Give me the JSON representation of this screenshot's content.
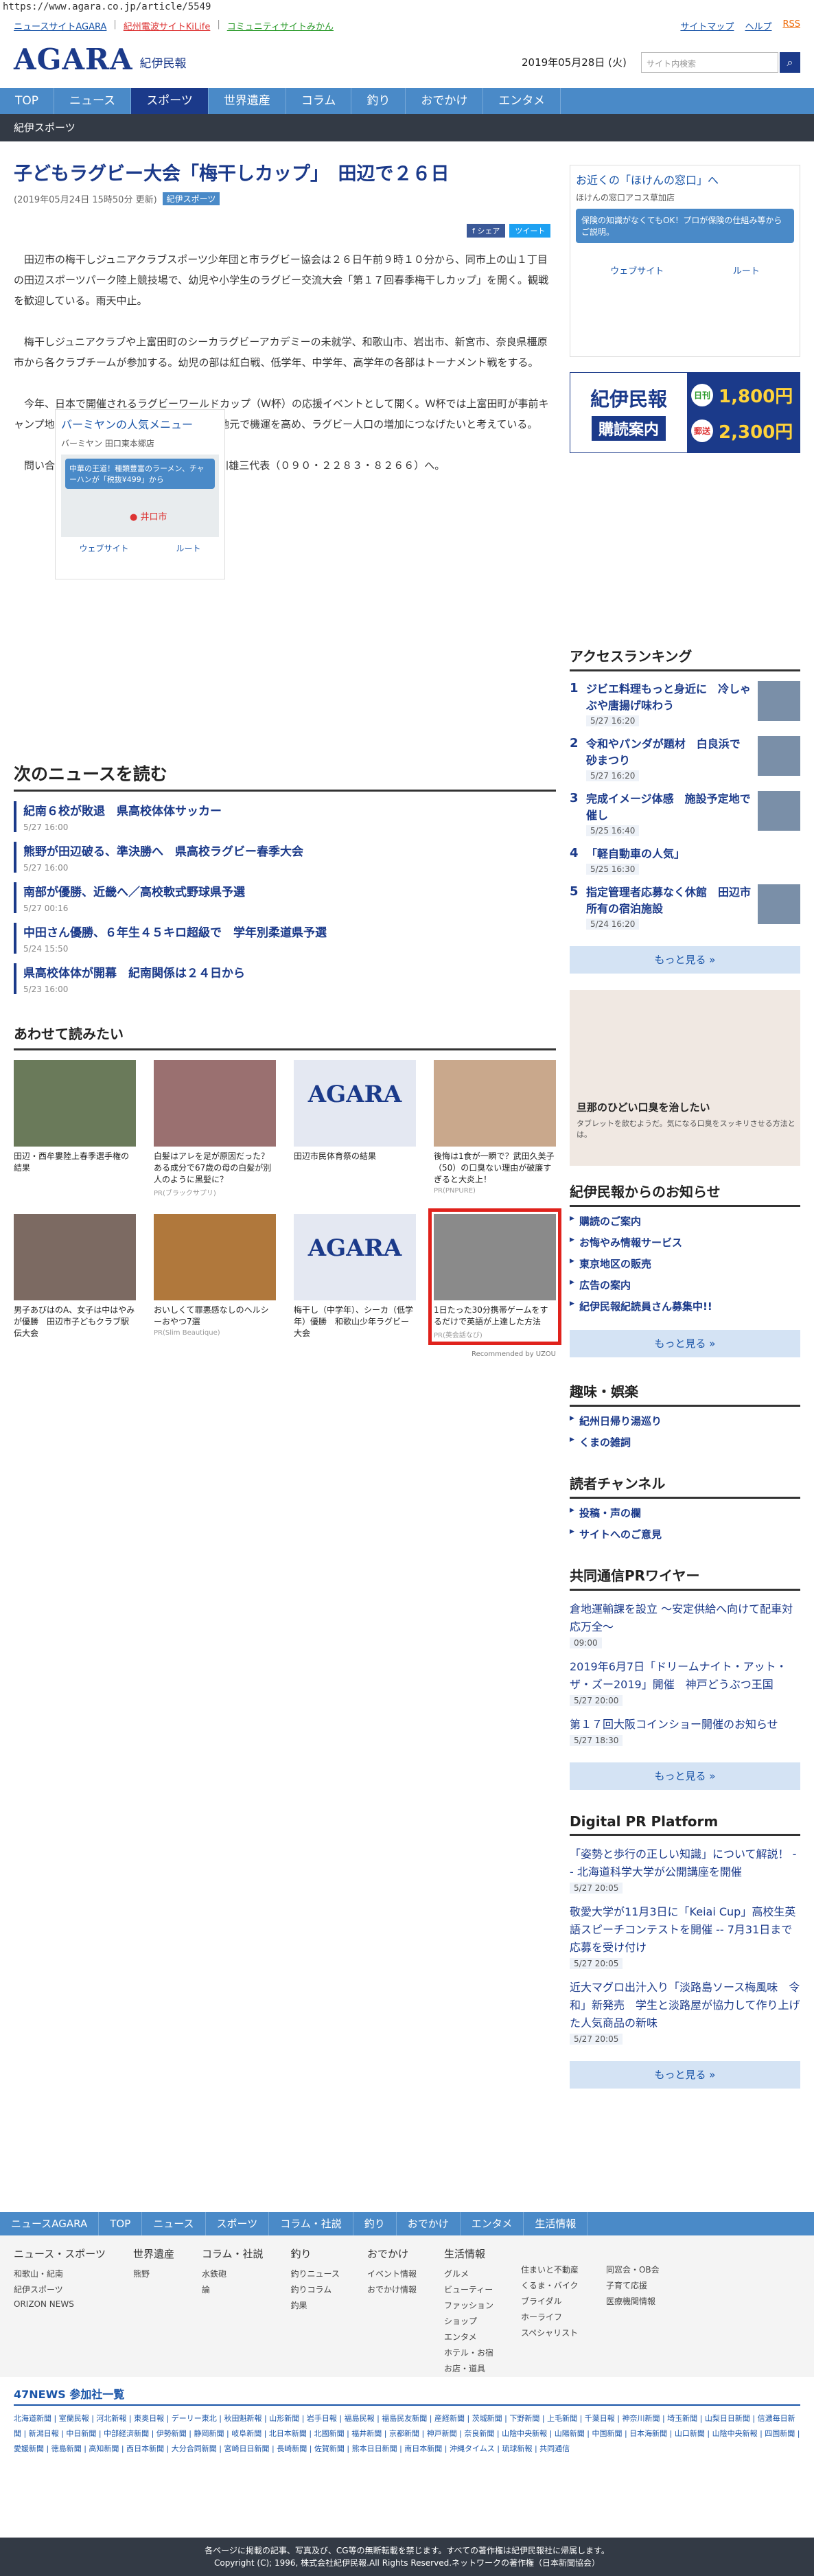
{
  "url": "https://www.agara.co.jp/article/5549",
  "toplinks": [
    "ニュースサイトAGARA",
    "紀州電波サイトKiLife",
    "コミュニティサイトみかん"
  ],
  "toprlinks": [
    "サイトマップ",
    "ヘルプ",
    "RSS"
  ],
  "logo": {
    "big": "AGARA",
    "small": "紀伊民報"
  },
  "date": "2019年05月28日 (火)",
  "search": {
    "placeholder": "サイト内検索"
  },
  "nav": [
    "TOP",
    "ニュース",
    "スポーツ",
    "世界遺産",
    "コラム",
    "釣り",
    "おでかけ",
    "エンタメ"
  ],
  "subnav": "紀伊スポーツ",
  "article": {
    "title": "子どもラグビー大会「梅干しカップ」　田辺で２６日",
    "meta": "(2019年05月24日 15時50分 更新)",
    "tag": "紀伊スポーツ",
    "share": [
      "f シェア",
      "ツイート"
    ],
    "paras": [
      "田辺市の梅干しジュニアクラブスポーツ少年団と市ラグビー協会は２６日午前９時１０分から、同市上の山１丁目の田辺スポーツパーク陸上競技場で、幼児や小学生のラグビー交流大会「第１７回春季梅干しカップ」を開く。観戦を歓迎している。雨天中止。",
      "梅干しジュニアクラブや上富田町のシーカラグビーアカデミーの未就学、和歌山市、岩出市、新宮市、奈良県橿原市から各クラブチームが参加する。幼児の部は紅白戦、低学年、中学年、高学年の各部はトーナメント戦をする。",
      "今年、日本で開催されるラグビーワールドカップ（Ｗ杯）の応援イベントとして開く。Ｗ杯では上富田町が事前キャンプ地の一つに選ばれている。主催者側は地元で機運を高め、ラグビー人口の増加につなげたいと考えている。",
      "問い合わせは、梅干しジュニアクラブの小川雄三代表（０９０・２２８３・８２６６）へ。"
    ]
  },
  "ad1": {
    "title": "バーミヤンの人気メニュー",
    "sub": "バーミヤン 田口東本郷店",
    "bubble": "中華の王道！種類豊富のラーメン、チャーハンが「税抜¥499」から",
    "pin": "井口市",
    "links": [
      "ウェブサイト",
      "ルート"
    ]
  },
  "next": {
    "heading": "次のニュースを読む",
    "items": [
      {
        "title": "紀南６校が敗退　県高校体体サッカー",
        "time": "5/27 16:00"
      },
      {
        "title": "熊野が田辺破る、準決勝へ　県高校ラグビー春季大会",
        "time": "5/27 16:00"
      },
      {
        "title": "南部が優勝、近畿へ／高校軟式野球県予選",
        "time": "5/27 00:16"
      },
      {
        "title": "中田さん優勝、６年生４５キロ超級で　学年別柔道県予選",
        "time": "5/24 15:50"
      },
      {
        "title": "県高校体体が開幕　紀南関係は２４日から",
        "time": "5/23 16:00"
      }
    ]
  },
  "related": {
    "heading": "あわせて読みたい",
    "cards": [
      {
        "cap": "田辺・西牟婁陸上春季選手権の結果",
        "pr": ""
      },
      {
        "cap": "白髪はアレを足が原因だった？ある成分で67歳の母の白髪が別人のように黒髪に？",
        "pr": "PR(ブラックサプリ)"
      },
      {
        "cap": "田辺市民体育祭の結果",
        "pr": ""
      },
      {
        "cap": "後悔は1食が一瞬で？武田久美子（50）の口臭ない理由が破廉すぎると大炎上！",
        "pr": "PR(PNPURE)"
      },
      {
        "cap": "男子あびはのA、女子は中はやみが優勝　田辺市子どもクラブ駅伝大会",
        "pr": ""
      },
      {
        "cap": "おいしくて罪悪感なしのヘルシーおやつ7選",
        "pr": "PR(Slim Beautique)"
      },
      {
        "cap": "梅干し（中学年）、シーカ（低学年）優勝　和歌山少年ラグビー大会",
        "pr": ""
      },
      {
        "cap": "1日たった30分携帯ゲームをするだけで英語が上達した方法",
        "pr": "PR(英会話なび)"
      }
    ],
    "recommended": "Recommended by UZOU"
  },
  "sad": {
    "title": "お近くの「ほけんの窓口」へ",
    "sub": "ほけんの窓口アコス草加店",
    "bubble": "保険の知識がなくてもOK！プロが保険の仕組み等からご説明。",
    "links": [
      "ウェブサイト",
      "ルート"
    ]
  },
  "kiban": {
    "a": "紀伊民報",
    "b": "購読案内",
    "p1": "1,800円",
    "p2": "2,300円",
    "l1": "日刊",
    "l2": "郵送"
  },
  "ranking": {
    "heading": "アクセスランキング",
    "items": [
      {
        "title": "ジビエ料理もっと身近に　冷しゃぶや唐揚げ味わう",
        "time": "5/27 16:20"
      },
      {
        "title": "令和やパンダが題材　白良浜で砂まつり",
        "time": "5/27 16:20"
      },
      {
        "title": "完成イメージ体感　施設予定地で催し",
        "time": "5/25 16:40"
      },
      {
        "title": "「軽自動車の人気」",
        "time": "5/25 16:30"
      },
      {
        "title": "指定管理者応募なく休館　田辺市所有の宿泊施設",
        "time": "5/24 16:20"
      }
    ]
  },
  "more": "もっと見る »",
  "sad2": {
    "title": "旦那のひどい口臭を治したい",
    "sub": "タブレットを飲むようだ。気になる口臭をスッキリさせる方法とは。"
  },
  "notice": {
    "heading": "紀伊民報からのお知らせ",
    "items": [
      "購読のご案内",
      "お悔やみ情報サービス",
      "東京地区の販売",
      "広告の案内",
      "紀伊民報紀読員さん募集中!!"
    ]
  },
  "hobby": {
    "heading": "趣味・娯楽",
    "items": [
      "紀州日帰り湯巡り",
      "くまの雑詞"
    ]
  },
  "reader": {
    "heading": "読者チャンネル",
    "items": [
      "投稿・声の欄",
      "サイトへのご意見"
    ]
  },
  "wire": {
    "heading": "共同通信PRワイヤー",
    "items": [
      {
        "title": "倉地運輸課を設立 ～安定供給へ向けて配車対応万全～",
        "time": "09:00"
      },
      {
        "title": "2019年6月7日「ドリームナイト・アット・ザ・ズー2019」開催　神戸どうぶつ王国",
        "time": "5/27 20:00"
      },
      {
        "title": "第１７回大阪コインショー開催のお知らせ",
        "time": "5/27 18:30"
      }
    ]
  },
  "dpr": {
    "heading": "Digital PR Platform",
    "items": [
      {
        "title": "「姿勢と歩行の正しい知識」について解説！ -- 北海道科学大学が公開講座を開催",
        "time": "5/27 20:05"
      },
      {
        "title": "敬愛大学が11月3日に「Keiai Cup」高校生英語スピーチコンテストを開催 -- 7月31日まで応募を受け付け",
        "time": "5/27 20:05"
      },
      {
        "title": "近大マグロ出汁入り「淡路島ソース梅風味　令和」新発売　学生と淡路屋が協力して作り上げた人気商品の新味",
        "time": "5/27 20:05"
      }
    ]
  },
  "footnav": [
    "ニュースAGARA",
    "TOP",
    "ニュース",
    "スポーツ",
    "コラム・社説",
    "釣り",
    "おでかけ",
    "エンタメ",
    "生活情報"
  ],
  "footcols": [
    {
      "h": "ニュース・スポーツ",
      "i": [
        "和歌山・紀南",
        "紀伊スポーツ",
        "ORIZON NEWS"
      ]
    },
    {
      "h": "世界遺産",
      "i": [
        "熊野"
      ]
    },
    {
      "h": "コラム・社説",
      "i": [
        "水鉄砲",
        "論"
      ]
    },
    {
      "h": "釣り",
      "i": [
        "釣りニュース",
        "釣りコラム",
        "釣果"
      ]
    },
    {
      "h": "おでかけ",
      "i": [
        "イベント情報",
        "おでかけ情報"
      ]
    },
    {
      "h": "生活情報",
      "i": [
        "グルメ",
        "ビューティー",
        "ファッション",
        "ショップ",
        "エンタメ",
        "ホテル・お宿",
        "お店・道具"
      ]
    },
    {
      "h": "",
      "i": [
        "住まいと不動産",
        "くるま・バイク",
        "ブライダル",
        "ホーライフ",
        "スペシャリスト"
      ]
    },
    {
      "h": "",
      "i": [
        "同窓会・OB会",
        "子育て応援",
        "医療機関情報"
      ]
    }
  ],
  "foot47": {
    "h": "47NEWS 参加社一覧",
    "papers": "北海道新聞 | 室蘭民報 | 河北新報 | 東奥日報 | デーリー東北 | 秋田魁新報 | 山形新聞 | 岩手日報 | 福島民報 | 福島民友新聞 | 産経新聞 | 茨城新聞 | 下野新聞 | 上毛新聞 | 千葉日報 | 神奈川新聞 | 埼玉新聞 | 山梨日日新聞 | 信濃毎日新聞 | 新潟日報 | 中日新聞 | 中部経済新聞 | 伊勢新聞 | 静岡新聞 | 岐阜新聞 | 北日本新聞 | 北國新聞 | 福井新聞 | 京都新聞 | 神戸新聞 | 奈良新聞 | 山陰中央新報 | 山陽新聞 | 中国新聞 | 日本海新聞 | 山口新聞 | 山陰中央新報 | 四国新聞 | 愛媛新聞 | 徳島新聞 | 高知新聞 | 西日本新聞 | 大分合同新聞 | 宮崎日日新聞 | 長崎新聞 | 佐賀新聞 | 熊本日日新聞 | 南日本新聞 | 沖縄タイムス | 琉球新報 | 共同通信"
  },
  "copyright": [
    "各ページに掲載の記事、写真及び、CG等の無断転載を禁じます。すべての著作権は紀伊民報社に帰属します。",
    "Copyright (C); 1996, 株式会社紀伊民報.All Rights Reserved.ネットワークの著作権（日本新聞協会）"
  ],
  "colors": {
    "brand": "#1b3a8a",
    "nav": "#4a8ac8",
    "highlight": "#e0221c"
  }
}
